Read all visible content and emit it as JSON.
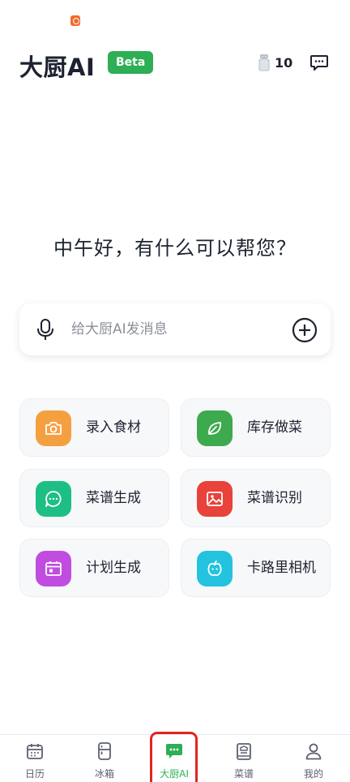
{
  "header": {
    "title": "大厨AI",
    "badge": "Beta",
    "salt_count": "10"
  },
  "greeting": "中午好，有什么可以帮您？",
  "input": {
    "placeholder": "给大厨AI发消息"
  },
  "features": [
    {
      "label": "录入食材",
      "icon": "camera-icon",
      "color": "#f5a040"
    },
    {
      "label": "库存做菜",
      "icon": "leaf-icon",
      "color": "#3daa4e"
    },
    {
      "label": "菜谱生成",
      "icon": "chat-bubble-icon",
      "color": "#1dbf84"
    },
    {
      "label": "菜谱识别",
      "icon": "image-icon",
      "color": "#e8423a"
    },
    {
      "label": "计划生成",
      "icon": "calendar-plan-icon",
      "color": "#c04de0"
    },
    {
      "label": "卡路里相机",
      "icon": "apple-face-icon",
      "color": "#23c3e0"
    }
  ],
  "tabs": [
    {
      "label": "日历",
      "icon": "calendar-icon",
      "active": false
    },
    {
      "label": "冰箱",
      "icon": "fridge-icon",
      "active": false
    },
    {
      "label": "大厨AI",
      "icon": "ai-chat-icon",
      "active": true
    },
    {
      "label": "菜谱",
      "icon": "recipe-book-icon",
      "active": false
    },
    {
      "label": "我的",
      "icon": "profile-icon",
      "active": false
    }
  ],
  "colors": {
    "accent": "#2eae55",
    "highlight": "#e0261f"
  }
}
